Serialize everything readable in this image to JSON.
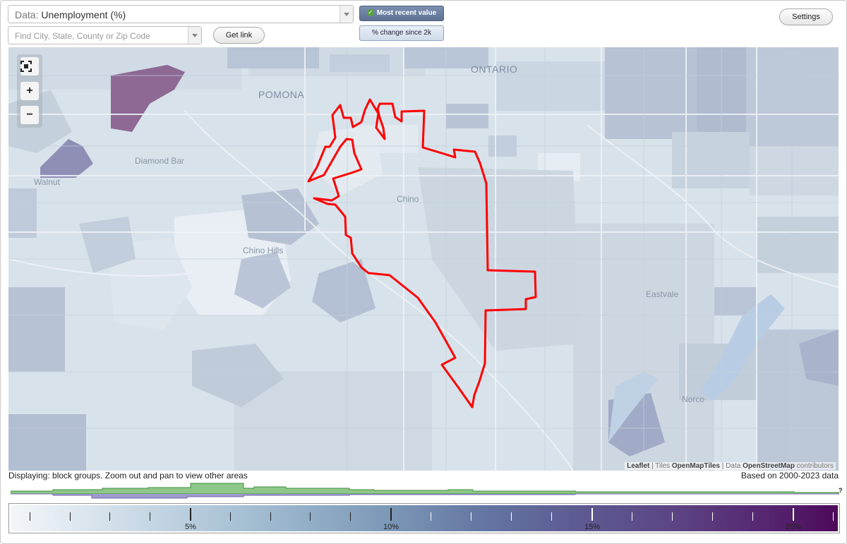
{
  "controls": {
    "data_label": "Data:",
    "data_value": "Unemployment (%)",
    "search_placeholder": "Find City, State, County or Zip Code",
    "get_link": "Get link",
    "most_recent": "Most recent value",
    "pct_change": "% change since 2k",
    "settings": "Settings"
  },
  "map": {
    "labels": {
      "ontario": "ONTARIO",
      "pomona": "POMONA",
      "diamond_bar": "Diamond Bar",
      "walnut": "Walnut",
      "chino": "Chino",
      "chino_hills": "Chino Hills",
      "eastvale": "Eastvale",
      "norco": "Norco"
    },
    "zoom": {
      "fit": "fit-bounds-icon",
      "in": "+",
      "out": "−"
    },
    "attribution": {
      "leaflet": "Leaflet",
      "sep1": " | Tiles ",
      "tiles": "OpenMapTiles",
      "sep2": " | Data ",
      "data": "OpenStreetMap",
      "suffix": " contributors"
    },
    "boundary_color": "#ff0000"
  },
  "status": {
    "displaying": "Displaying: block groups. Zoom out and pan to view other areas",
    "based_on": "Based on 2000-2023 data"
  },
  "histogram": {
    "help": "?"
  },
  "legend": {
    "labels": [
      "5%",
      "10%",
      "15%",
      "20%"
    ],
    "low_color": "#f3f6f9",
    "high_color": "#4d0a5a"
  }
}
